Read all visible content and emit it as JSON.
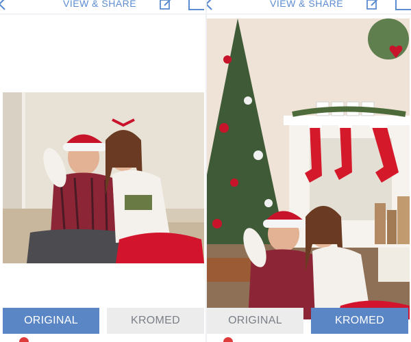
{
  "header": {
    "title": "VIEW & SHARE",
    "back_icon": "chevron-left-icon",
    "edit_icon": "edit-icon",
    "share_icon": "share-icon"
  },
  "panes": {
    "left": {
      "mode": "original",
      "photo_desc": "Two children in holiday outfits sitting on carpet"
    },
    "right": {
      "mode": "kromed",
      "photo_desc": "Two children in front of decorated Christmas tree and fireplace with stockings and XMAS letters"
    }
  },
  "tabs": {
    "original_label": "ORIGINAL",
    "kromed_label": "KROMED"
  },
  "colors": {
    "accent": "#5b86c5",
    "tab_inactive_bg": "#ececec",
    "tab_inactive_text": "#7a7f87",
    "title_color": "#5b8bd1"
  }
}
